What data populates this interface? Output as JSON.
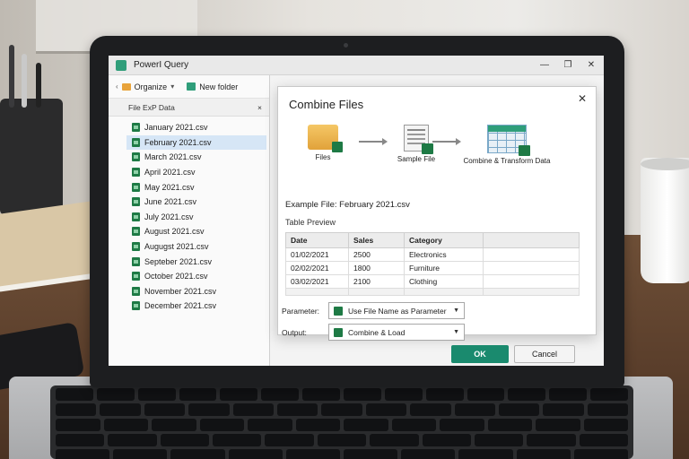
{
  "window": {
    "title": "PowerI Query",
    "controls": [
      "—",
      "❐",
      "✕"
    ]
  },
  "explorer": {
    "organize_label": "Organize",
    "new_folder_label": "New folder",
    "path_label": "File ExP Data",
    "path_close": "×",
    "files": [
      "January 2021.csv",
      "February 2021.csv",
      "March 2021.csv",
      "April 2021.csv",
      "May 2021.csv",
      "June 2021.csv",
      "July 2021.csv",
      "August 2021.csv",
      "Augugst 2021.csv",
      "Septeber 2021.csv",
      "October 2021.csv",
      "November 2021.csv",
      "December 2021.csv"
    ],
    "selected_file": "February 2021.csv"
  },
  "dialog": {
    "title": "Combine Files",
    "close": "✕",
    "steps": [
      "Files",
      "Sample File",
      "Combine & Transform Data"
    ],
    "example_file": "Example File: February 2021.csv",
    "table_preview_label": "Table Preview",
    "table": {
      "headers": [
        "Date",
        "Sales",
        "Category",
        ""
      ],
      "rows": [
        [
          "01/02/2021",
          "2500",
          "Electronics",
          ""
        ],
        [
          "02/02/2021",
          "1800",
          "Furniture",
          ""
        ],
        [
          "03/02/2021",
          "2100",
          "Clothing",
          ""
        ]
      ]
    },
    "parameter_label": "Parameter:",
    "parameter_value": "Use File Name as Parameter",
    "output_label": "Output:",
    "output_value": "Combine & Load",
    "ok_label": "OK",
    "cancel_label": "Cancel"
  },
  "colors": {
    "accent": "#1a8a6e",
    "selection": "#d6e6f6",
    "excel_green": "#1e7a45"
  }
}
